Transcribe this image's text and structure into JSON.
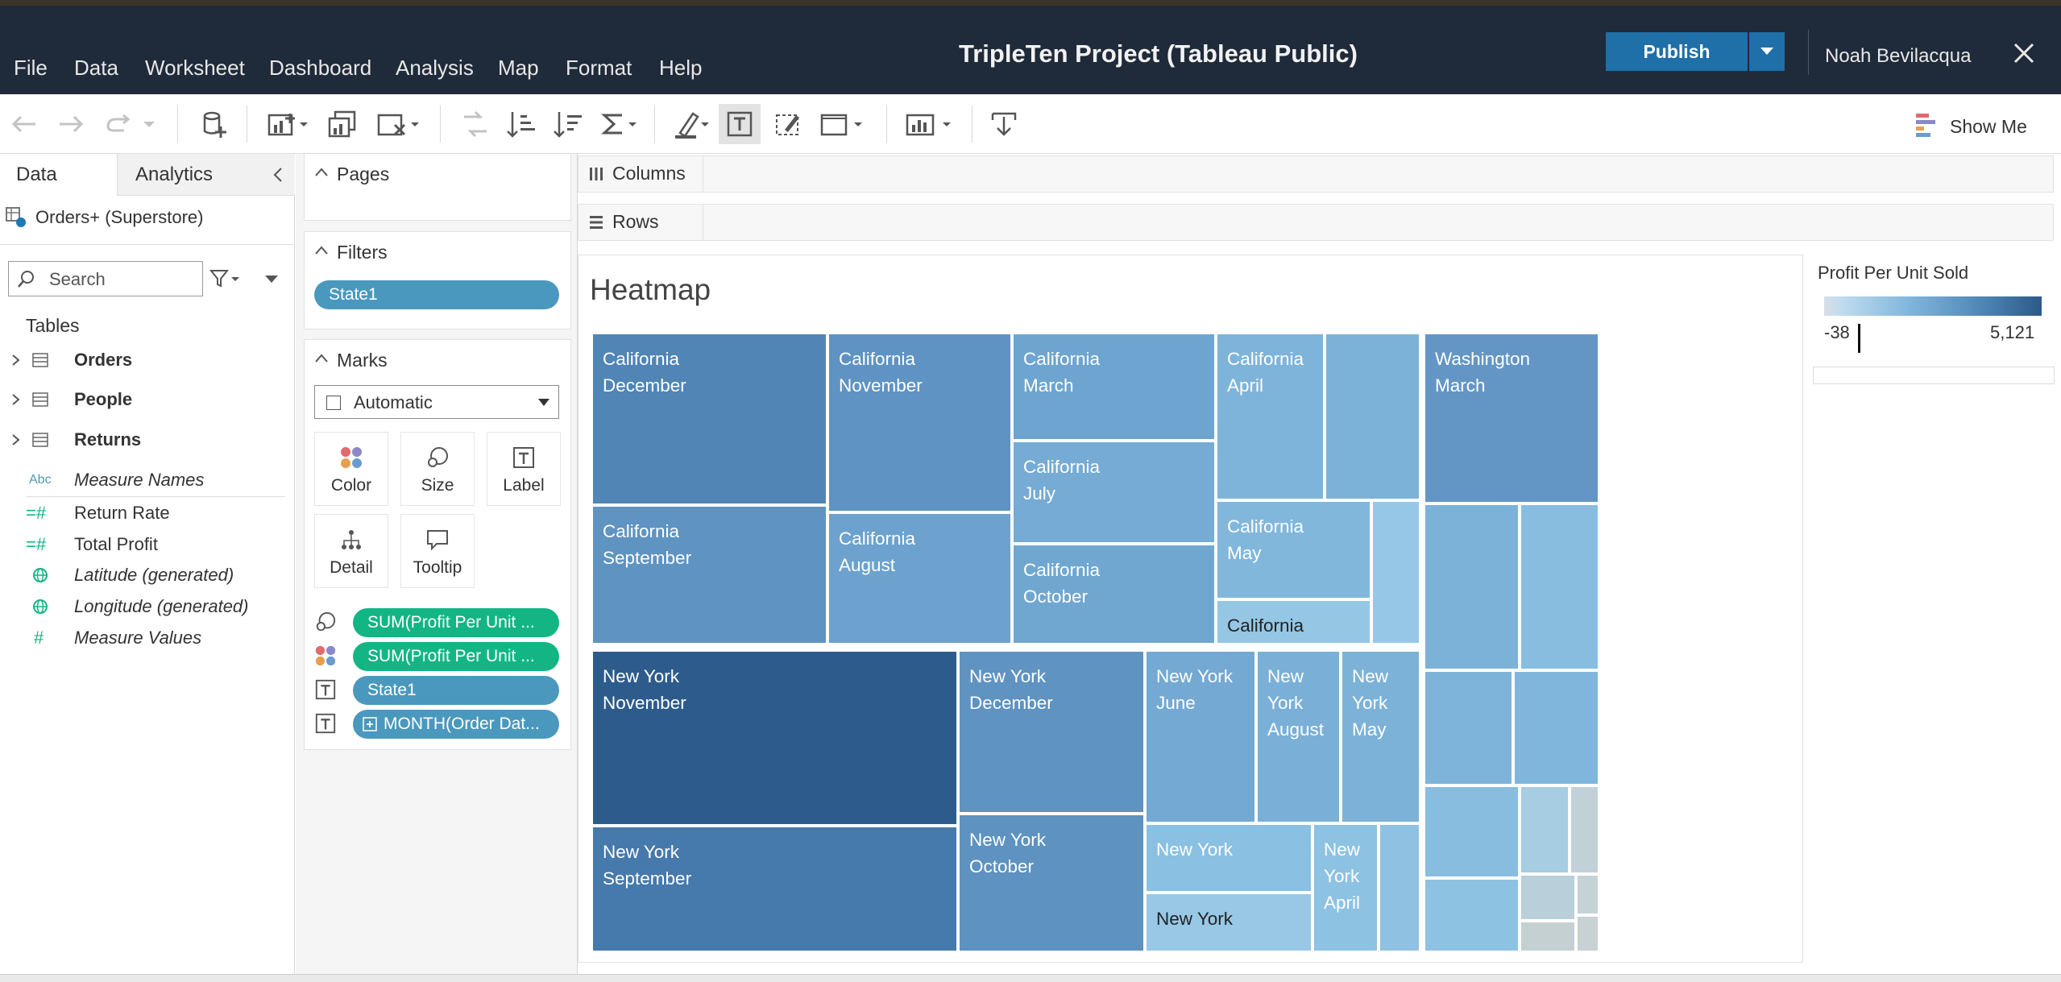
{
  "app": {
    "title": "TripleTen Project (Tableau Public)",
    "publish_label": "Publish",
    "user_name": "Noah Bevilacqua"
  },
  "menu": [
    "File",
    "Data",
    "Worksheet",
    "Dashboard",
    "Analysis",
    "Map",
    "Format",
    "Help"
  ],
  "toolbar": {
    "show_me_label": "Show Me"
  },
  "left_pane": {
    "tabs": [
      "Data",
      "Analytics"
    ],
    "data_source": "Orders+ (Superstore)",
    "search_placeholder": "Search",
    "tables_heading": "Tables",
    "tables": [
      "Orders",
      "People",
      "Returns"
    ],
    "fields": [
      {
        "name": "Measure Names",
        "type": "Abc",
        "italic": true
      },
      {
        "name": "Return Rate",
        "type": "measure",
        "italic": false
      },
      {
        "name": "Total Profit",
        "type": "measure",
        "italic": false
      },
      {
        "name": "Latitude (generated)",
        "type": "geo",
        "italic": true
      },
      {
        "name": "Longitude (generated)",
        "type": "geo",
        "italic": true
      },
      {
        "name": "Measure Values",
        "type": "measure",
        "italic": true
      }
    ]
  },
  "cards": {
    "pages_label": "Pages",
    "filters_label": "Filters",
    "filter_pill": "State1",
    "marks_label": "Marks",
    "mark_type": "Automatic",
    "mark_buttons": [
      "Color",
      "Size",
      "Label",
      "Detail",
      "Tooltip"
    ],
    "mark_pills": [
      {
        "icon": "size",
        "label": "SUM(Profit Per Unit ...",
        "color": "green"
      },
      {
        "icon": "color",
        "label": "SUM(Profit Per Unit ...",
        "color": "green"
      },
      {
        "icon": "label",
        "label": "State1",
        "color": "blue"
      },
      {
        "icon": "label",
        "label": "MONTH(Order Dat...",
        "color": "blue"
      }
    ]
  },
  "shelves": {
    "columns_label": "Columns",
    "rows_label": "Rows"
  },
  "viz": {
    "title": "Heatmap"
  },
  "legend": {
    "title": "Profit Per Unit Sold",
    "min": "-38",
    "max": "5,121"
  },
  "chart_data": {
    "type": "heatmap",
    "title": "Heatmap",
    "measure": "Profit Per Unit Sold",
    "color_range": [
      -38,
      5121
    ],
    "colors": {
      "low": "#d7dfe6",
      "high": "#2c5a89"
    },
    "cells": [
      {
        "label": "California\nDecember",
        "color": "#5085b6"
      },
      {
        "label": "California\nSeptember",
        "color": "#5f93c2"
      },
      {
        "label": "California\nNovember",
        "color": "#5f93c3"
      },
      {
        "label": "California\nAugust",
        "color": "#6ca2cd"
      },
      {
        "label": "California\nMarch",
        "color": "#6ea5d0"
      },
      {
        "label": "California\nJuly",
        "color": "#75abd4"
      },
      {
        "label": "California\nOctober",
        "color": "#70a7d1"
      },
      {
        "label": "California\nApril",
        "color": "#7fb4da"
      },
      {
        "label": "",
        "color": "#7cb2d8"
      },
      {
        "label": "California\nMay",
        "color": "#82b7dc"
      },
      {
        "label": "",
        "color": "#96c7e6"
      },
      {
        "label": "California",
        "color": "#95c6e4"
      },
      {
        "label": "New York\nNovember",
        "color": "#2d5c8c"
      },
      {
        "label": "New York\nSeptember",
        "color": "#4679ac"
      },
      {
        "label": "New York\nDecember",
        "color": "#5e93c2"
      },
      {
        "label": "New York\nOctober",
        "color": "#5d92c1"
      },
      {
        "label": "New York\nJune",
        "color": "#73a9d3"
      },
      {
        "label": "New\nYork\nAugust",
        "color": "#7ab0d7"
      },
      {
        "label": "New\nYork\nMay",
        "color": "#7cb2d8"
      },
      {
        "label": "New York",
        "color": "#8ac0e2"
      },
      {
        "label": "New York",
        "color": "#98c8e6"
      },
      {
        "label": "New\nYork\nApril",
        "color": "#8dc2e3"
      },
      {
        "label": "",
        "color": "#8fc2e2"
      },
      {
        "label": "Washington\nMarch",
        "color": "#6496c5"
      },
      {
        "label": "",
        "color": "#7cb2d8"
      },
      {
        "label": "",
        "color": "#88bde0"
      },
      {
        "label": "",
        "color": "#7fb4da"
      },
      {
        "label": "",
        "color": "#80b6db"
      },
      {
        "label": "",
        "color": "#88bde0"
      },
      {
        "label": "",
        "color": "#a6cde2"
      },
      {
        "label": "",
        "color": "#c2d1d8"
      },
      {
        "label": "",
        "color": "#8ec2e3"
      },
      {
        "label": "",
        "color": "#b9cfd9"
      },
      {
        "label": "",
        "color": "#c5d0d3"
      },
      {
        "label": "",
        "color": "#c5d2d6"
      },
      {
        "label": "",
        "color": "#c8d1d3"
      }
    ]
  }
}
